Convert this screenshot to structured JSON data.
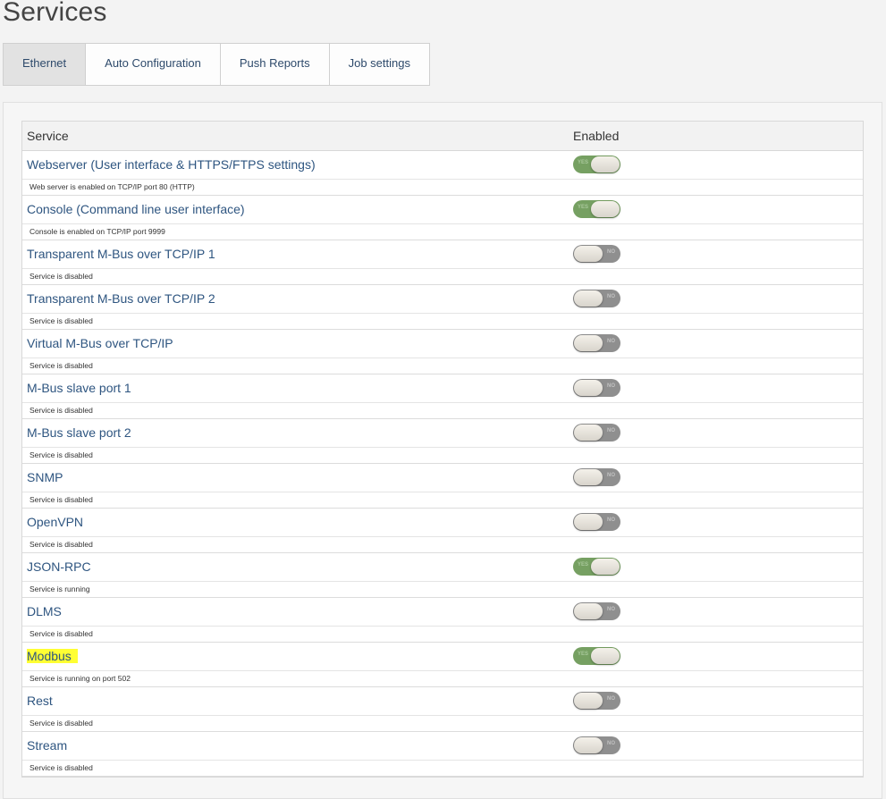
{
  "page": {
    "title": "Services"
  },
  "tabs": [
    {
      "label": "Ethernet",
      "active": true
    },
    {
      "label": "Auto Configuration",
      "active": false
    },
    {
      "label": "Push Reports",
      "active": false
    },
    {
      "label": "Job settings",
      "active": false
    }
  ],
  "table": {
    "headers": {
      "service": "Service",
      "enabled": "Enabled"
    },
    "toggle_labels": {
      "on": "YES",
      "off": "NO"
    },
    "colors": {
      "on": "#76a062",
      "off": "#8f8f8f",
      "highlight": "#ffff33",
      "link": "#2e5580"
    },
    "rows": [
      {
        "name": "Webserver (User interface & HTTPS/FTPS settings)",
        "desc": "Web server is enabled on TCP/IP port 80 (HTTP)",
        "enabled": true
      },
      {
        "name": "Console (Command line user interface)",
        "desc": "Console is enabled on TCP/IP port 9999",
        "enabled": true
      },
      {
        "name": "Transparent M-Bus over TCP/IP 1",
        "desc": "Service is disabled",
        "enabled": false
      },
      {
        "name": "Transparent M-Bus over TCP/IP 2",
        "desc": "Service is disabled",
        "enabled": false
      },
      {
        "name": "Virtual M-Bus over TCP/IP",
        "desc": "Service is disabled",
        "enabled": false
      },
      {
        "name": "M-Bus slave port 1",
        "desc": "Service is disabled",
        "enabled": false
      },
      {
        "name": "M-Bus slave port 2",
        "desc": "Service is disabled",
        "enabled": false
      },
      {
        "name": "SNMP",
        "desc": "Service is disabled",
        "enabled": false
      },
      {
        "name": "OpenVPN",
        "desc": "Service is disabled",
        "enabled": false
      },
      {
        "name": "JSON-RPC",
        "desc": "Service is running",
        "enabled": true
      },
      {
        "name": "DLMS",
        "desc": "Service is disabled",
        "enabled": false
      },
      {
        "name": "Modbus",
        "desc": "Service is running on port 502",
        "enabled": true,
        "highlighted": true
      },
      {
        "name": "Rest",
        "desc": "Service is disabled",
        "enabled": false
      },
      {
        "name": "Stream",
        "desc": "Service is disabled",
        "enabled": false
      }
    ]
  }
}
